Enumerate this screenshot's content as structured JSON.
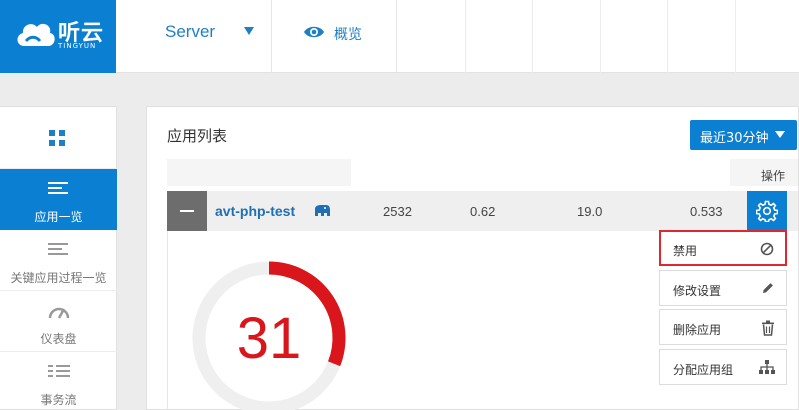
{
  "brand": {
    "name": "听云",
    "sub": "TINGYUN"
  },
  "topnav": {
    "server_label": "Server",
    "overview_label": "概览"
  },
  "sidebar": {
    "items": [
      {
        "label": "应用一览",
        "icon": "list-icon",
        "active": true
      },
      {
        "label": "关键应用过程一览",
        "icon": "list-icon",
        "active": false
      },
      {
        "label": "仪表盘",
        "icon": "dashboard-icon",
        "active": false
      },
      {
        "label": "事务流",
        "icon": "flow-icon",
        "active": false
      }
    ]
  },
  "panel": {
    "title": "应用列表",
    "time_range": "最近30分钟",
    "op_header": "操作"
  },
  "app_row": {
    "name": "avt-php-test",
    "values": [
      "2532",
      "0.62",
      "19.0",
      "0.533"
    ]
  },
  "gauge": {
    "value": "31",
    "fraction": 0.31,
    "color": "#d9161c"
  },
  "menu": {
    "items": [
      {
        "label": "禁用",
        "icon": "ban-icon"
      },
      {
        "label": "修改设置",
        "icon": "pencil-icon"
      },
      {
        "label": "删除应用",
        "icon": "trash-icon"
      },
      {
        "label": "分配应用组",
        "icon": "hierarchy-icon"
      }
    ]
  },
  "colors": {
    "primary": "#0b7fd1",
    "highlight_border": "#e0262e"
  }
}
